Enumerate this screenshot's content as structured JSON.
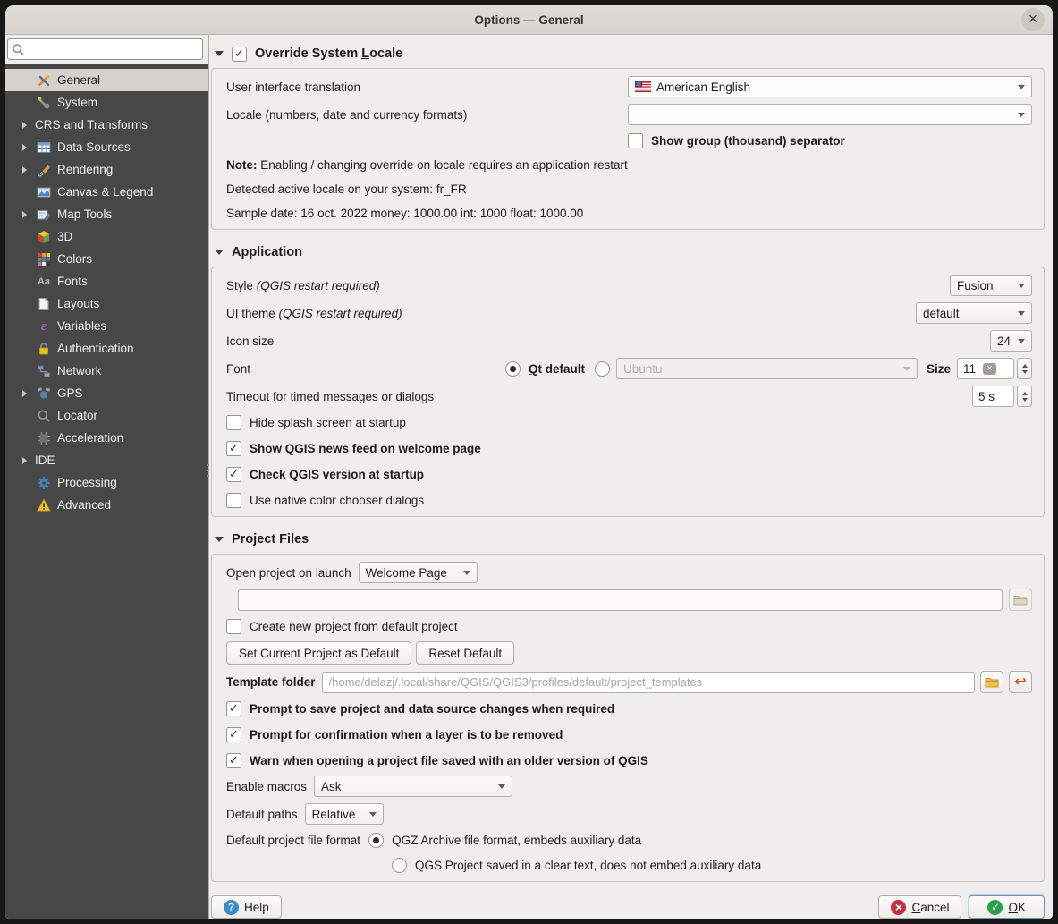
{
  "window": {
    "title": "Options — General"
  },
  "icons": {
    "search": "magnifier",
    "close": "×",
    "help": "?",
    "cancel": "×",
    "ok": "✓",
    "folder": "folder",
    "reset": "↩",
    "clear": "×",
    "fonts_glyph": "Aa",
    "variables_glyph": "ε"
  },
  "colors": {
    "sidebar_bg": "#474747",
    "selection_bg": "#d5d2ce",
    "window_bg": "#f0eeec",
    "help_blue": "#3a8bc9",
    "cancel_red": "#c62f3e",
    "ok_green": "#2e9e4f",
    "folder_yellow": "#e8b93c",
    "reset_orange": "#d14f28",
    "auth_lock_yellow": "#e3c51d",
    "warning_yellow": "#f2c12e",
    "processing_blue": "#477db8"
  },
  "sidebar": {
    "search_placeholder": "",
    "items": [
      {
        "label": "General",
        "icon": "general-icon",
        "selected": true
      },
      {
        "label": "System",
        "icon": "system-icon"
      },
      {
        "label": "CRS and Transforms",
        "expandable": true
      },
      {
        "label": "Data Sources",
        "icon": "data-sources-icon",
        "expandable": true
      },
      {
        "label": "Rendering",
        "icon": "rendering-icon",
        "expandable": true
      },
      {
        "label": "Canvas & Legend",
        "icon": "canvas-legend-icon"
      },
      {
        "label": "Map Tools",
        "icon": "map-tools-icon",
        "expandable": true
      },
      {
        "label": "3D",
        "icon": "3d-icon"
      },
      {
        "label": "Colors",
        "icon": "colors-icon"
      },
      {
        "label": "Fonts",
        "icon": "fonts-icon"
      },
      {
        "label": "Layouts",
        "icon": "layouts-icon"
      },
      {
        "label": "Variables",
        "icon": "variables-icon"
      },
      {
        "label": "Authentication",
        "icon": "authentication-icon"
      },
      {
        "label": "Network",
        "icon": "network-icon"
      },
      {
        "label": "GPS",
        "icon": "gps-icon",
        "expandable": true
      },
      {
        "label": "Locator",
        "icon": "locator-icon"
      },
      {
        "label": "Acceleration",
        "icon": "acceleration-icon"
      },
      {
        "label": "IDE",
        "expandable": true
      },
      {
        "label": "Processing",
        "icon": "processing-icon"
      },
      {
        "label": "Advanced",
        "icon": "advanced-icon"
      }
    ]
  },
  "locale": {
    "title_pre": "Override System ",
    "title_mn": "L",
    "title_post": "ocale",
    "checkbox_checked": true,
    "ui_translation_label": "User interface translation",
    "ui_translation_value": "American English",
    "locale_label": "Locale (numbers, date and currency formats)",
    "locale_value": "",
    "separator_label": "Show group (thousand) separator",
    "note_label": "Note:",
    "note_text": " Enabling / changing override on locale requires an application restart",
    "detected_text": "Detected active locale on your system: fr_FR",
    "sample_text": "Sample date: 16 oct. 2022 money: 1000.00 int: 1000 float: 1000.00"
  },
  "application": {
    "title": "Application",
    "style_label": "Style ",
    "ui_theme_label": "UI theme ",
    "restart_required": "(QGIS restart required)",
    "style_value": "Fusion",
    "ui_theme_value": "default",
    "icon_size_label": "Icon size",
    "icon_size_value": "24",
    "font_label": "Font",
    "qt_default_mn": "Q",
    "qt_default_rest": "t default",
    "font_family_value": "Ubuntu",
    "size_label": "Size",
    "size_value": "11",
    "timeout_label": "Timeout for timed messages or dialogs",
    "timeout_value": "5 s",
    "cb_hide_splash": "Hide splash screen at startup",
    "cb_news_feed": "Show QGIS news feed on welcome page",
    "cb_check_version": "Check QGIS version at startup",
    "cb_native_color": "Use native color chooser dialogs"
  },
  "project_files": {
    "title": "Project Files",
    "open_on_launch_label": "Open project on launch",
    "open_on_launch_value": "Welcome Page",
    "project_path_value": "",
    "cb_create_default": "Create new project from default project",
    "btn_set_current": "Set Current Project as Default",
    "btn_reset_default": "Reset Default",
    "template_folder_label": "Template folder",
    "template_folder_placeholder": "/home/delazj/.local/share/QGIS/QGIS3/profiles/default/project_templates",
    "cb_prompt_save": "Prompt to save project and data source changes when required",
    "cb_prompt_layer": "Prompt for confirmation when a layer is to be removed",
    "cb_warn_older": "Warn when opening a project file saved with an older version of QGIS",
    "enable_macros_label": "Enable macros",
    "enable_macros_value": "Ask",
    "default_paths_label": "Default paths",
    "default_paths_value": "Relative",
    "file_format_label": "Default project file format",
    "qgz_option": "QGZ Archive file format, embeds auxiliary data",
    "qgs_option": "QGS Project saved in a clear text, does not embed auxiliary data"
  },
  "footer": {
    "help": "Help",
    "cancel_mn": "C",
    "cancel_rest": "ancel",
    "ok_mn": "O",
    "ok_rest": "K"
  }
}
